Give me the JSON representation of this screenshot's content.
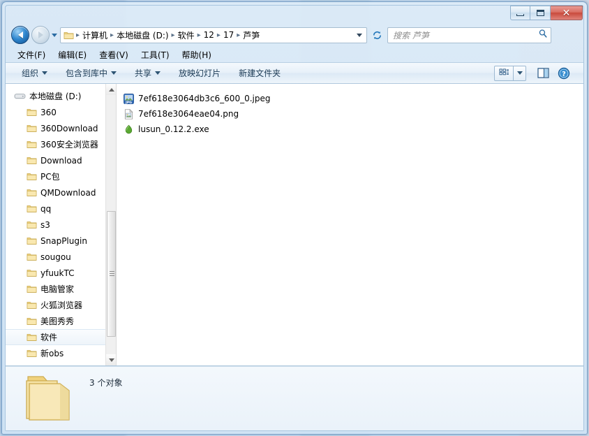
{
  "window": {
    "controls": {
      "minimize": "–",
      "maximize": "□",
      "close": "✕"
    }
  },
  "address": {
    "folder_icon": "folder-icon",
    "breadcrumbs": [
      "计算机",
      "本地磁盘 (D:)",
      "软件",
      "12",
      "17",
      "芦笋"
    ],
    "separator": "▸",
    "dropdown_icon": "chevron-down-icon",
    "refresh_icon": "refresh-icon"
  },
  "navigation": {
    "back_icon": "arrow-left-icon",
    "forward_icon": "arrow-right-icon",
    "history_icon": "chevron-down-icon"
  },
  "search": {
    "placeholder": "搜索 芦笋",
    "icon": "search-icon"
  },
  "menu": {
    "items": [
      {
        "label": "文件(F)"
      },
      {
        "label": "编辑(E)"
      },
      {
        "label": "查看(V)"
      },
      {
        "label": "工具(T)"
      },
      {
        "label": "帮助(H)"
      }
    ]
  },
  "toolbar": {
    "items": [
      {
        "label": "组织",
        "has_caret": true
      },
      {
        "label": "包含到库中",
        "has_caret": true
      },
      {
        "label": "共享",
        "has_caret": true
      },
      {
        "label": "放映幻灯片",
        "has_caret": false
      },
      {
        "label": "新建文件夹",
        "has_caret": false
      }
    ],
    "view_icon": "view-mode-icon",
    "view_caret_icon": "chevron-down-icon",
    "preview_pane_icon": "preview-pane-icon",
    "help_icon": "help-icon"
  },
  "sidebar": {
    "root": {
      "label": "本地磁盘 (D:)",
      "icon": "drive-icon"
    },
    "items": [
      {
        "label": "360",
        "icon": "folder-icon",
        "selected": false
      },
      {
        "label": "360Download",
        "icon": "folder-icon",
        "selected": false
      },
      {
        "label": "360安全浏览器",
        "icon": "folder-icon",
        "selected": false
      },
      {
        "label": "Download",
        "icon": "folder-icon",
        "selected": false
      },
      {
        "label": "PC包",
        "icon": "folder-icon",
        "selected": false
      },
      {
        "label": "QMDownload",
        "icon": "folder-icon",
        "selected": false
      },
      {
        "label": "qq",
        "icon": "folder-icon",
        "selected": false
      },
      {
        "label": "s3",
        "icon": "folder-icon",
        "selected": false
      },
      {
        "label": "SnapPlugin",
        "icon": "folder-icon",
        "selected": false
      },
      {
        "label": "sougou",
        "icon": "folder-icon",
        "selected": false
      },
      {
        "label": "yfuukTC",
        "icon": "folder-icon",
        "selected": false
      },
      {
        "label": "电脑管家",
        "icon": "folder-icon",
        "selected": false
      },
      {
        "label": "火狐浏览器",
        "icon": "folder-icon",
        "selected": false
      },
      {
        "label": "美图秀秀",
        "icon": "folder-icon",
        "selected": false
      },
      {
        "label": "软件",
        "icon": "folder-icon",
        "selected": true
      },
      {
        "label": "新obs",
        "icon": "folder-icon",
        "selected": false
      }
    ],
    "scrollbar": {
      "up_icon": "chevron-up-icon",
      "down_icon": "chevron-down-icon"
    }
  },
  "files": {
    "items": [
      {
        "name": "7ef618e3064db3c6_600_0.jpeg",
        "icon": "jpeg-file-icon",
        "icon_label": "JPG"
      },
      {
        "name": "7ef618e3064eae04.png",
        "icon": "png-file-icon",
        "icon_label": ""
      },
      {
        "name": "lusun_0.12.2.exe",
        "icon": "leaf-app-icon",
        "icon_label": ""
      }
    ]
  },
  "status": {
    "folder_icon": "open-folder-icon",
    "text": "3 个对象"
  },
  "colors": {
    "accent": "#2f87cf",
    "close_button": "#c94a3c",
    "folder_yellow": "#f5d87f",
    "leaf_green": "#5aa832",
    "window_border": "#7ba3c9"
  }
}
